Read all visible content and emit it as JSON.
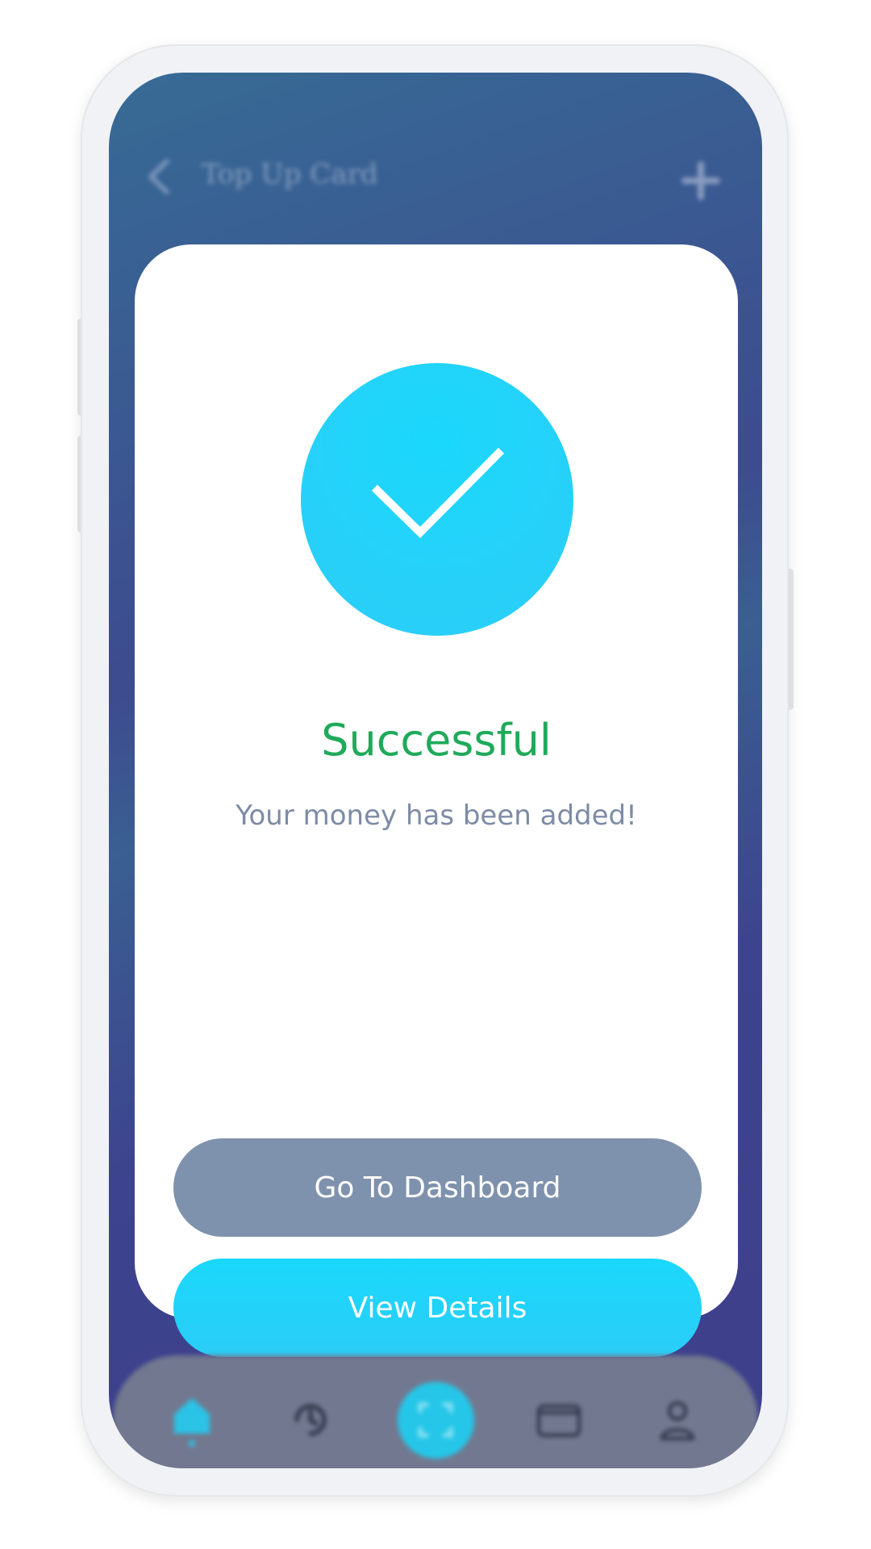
{
  "header": {
    "title": "Top Up Card"
  },
  "dialog": {
    "title": "Successful",
    "message": "Your money has been added!",
    "primary_button_label": "Go To Dashboard",
    "secondary_button_label": "View Details"
  },
  "bottom_nav": {
    "items": [
      {
        "icon": "home-icon",
        "active": true
      },
      {
        "icon": "history-icon",
        "active": false
      },
      {
        "icon": "scan-icon",
        "active": false
      },
      {
        "icon": "wallet-icon",
        "active": false
      },
      {
        "icon": "profile-icon",
        "active": false
      }
    ]
  },
  "colors": {
    "accent": "#1ad8fb",
    "success": "#1faa5a",
    "secondary_button": "#7f92ad",
    "background_start": "#376b95",
    "background_end": "#3e3f8b",
    "muted_text": "#7d8ba5"
  }
}
